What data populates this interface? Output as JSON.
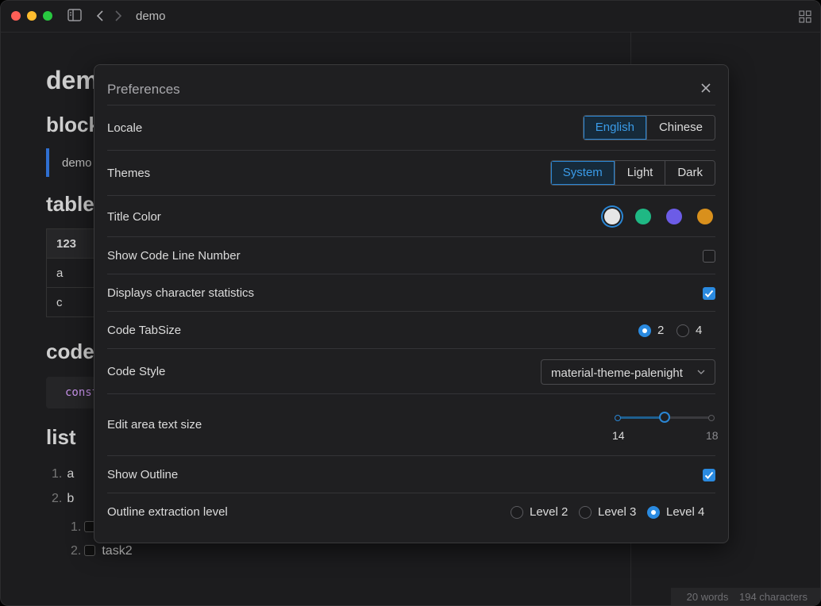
{
  "window": {
    "title": "demo"
  },
  "document": {
    "heading1": "dem",
    "headings": [
      "block",
      "table",
      "code",
      "list"
    ],
    "blockquote": "demo",
    "table": {
      "header": "123",
      "rows": [
        "a",
        "c"
      ]
    },
    "code": "const",
    "list": [
      {
        "num": "1.",
        "text": "a"
      },
      {
        "num": "2.",
        "text": "b"
      }
    ],
    "tasks": [
      {
        "num": "1.",
        "text": ""
      },
      {
        "num": "2.",
        "text": "task2"
      }
    ]
  },
  "status_bar": {
    "words": "20 words",
    "characters": "194 characters"
  },
  "preferences": {
    "title": "Preferences",
    "locale": {
      "label": "Locale",
      "options": [
        "English",
        "Chinese"
      ],
      "selected": "English"
    },
    "themes": {
      "label": "Themes",
      "options": [
        "System",
        "Light",
        "Dark"
      ],
      "selected": "System"
    },
    "title_color": {
      "label": "Title Color",
      "colors": [
        "#e6e6e6",
        "#1fb884",
        "#6c5ce7",
        "#d9901c"
      ],
      "selected_index": 0
    },
    "show_code_line_number": {
      "label": "Show Code Line Number",
      "checked": false
    },
    "character_statistics": {
      "label": "Displays character statistics",
      "checked": true
    },
    "code_tabsize": {
      "label": "Code TabSize",
      "options": [
        "2",
        "4"
      ],
      "selected": "2"
    },
    "code_style": {
      "label": "Code Style",
      "value": "material-theme-palenight"
    },
    "edit_text_size": {
      "label": "Edit area text size",
      "min": "14",
      "max": "18",
      "value": 16
    },
    "show_outline": {
      "label": "Show Outline",
      "checked": true
    },
    "outline_level": {
      "label": "Outline extraction level",
      "options": [
        "Level 2",
        "Level 3",
        "Level 4"
      ],
      "selected": "Level 4"
    }
  },
  "colors": {
    "accent": "#2a86d4"
  }
}
